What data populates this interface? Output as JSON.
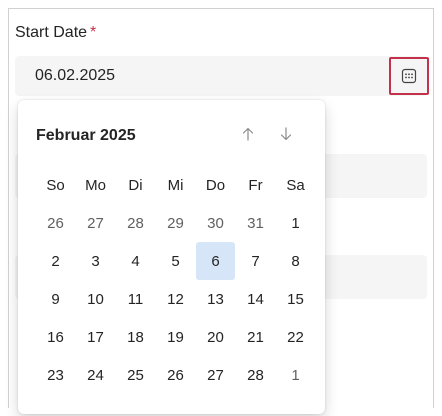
{
  "field": {
    "label": "Start Date",
    "required_mark": "*",
    "value": "06.02.2025",
    "calendar_button_icon": "calendar-icon"
  },
  "calendar": {
    "month_title": "Februar 2025",
    "prev_icon": "arrow-up-icon",
    "next_icon": "arrow-down-icon",
    "weekdays": [
      "So",
      "Mo",
      "Di",
      "Mi",
      "Do",
      "Fr",
      "Sa"
    ],
    "weeks": [
      [
        {
          "d": "26",
          "out": true
        },
        {
          "d": "27",
          "out": true
        },
        {
          "d": "28",
          "out": true
        },
        {
          "d": "29",
          "out": true
        },
        {
          "d": "30",
          "out": true
        },
        {
          "d": "31",
          "out": true
        },
        {
          "d": "1",
          "out": false
        }
      ],
      [
        {
          "d": "2"
        },
        {
          "d": "3"
        },
        {
          "d": "4"
        },
        {
          "d": "5"
        },
        {
          "d": "6",
          "selected": true
        },
        {
          "d": "7"
        },
        {
          "d": "8"
        }
      ],
      [
        {
          "d": "9"
        },
        {
          "d": "10"
        },
        {
          "d": "11"
        },
        {
          "d": "12"
        },
        {
          "d": "13"
        },
        {
          "d": "14"
        },
        {
          "d": "15"
        }
      ],
      [
        {
          "d": "16"
        },
        {
          "d": "17"
        },
        {
          "d": "18"
        },
        {
          "d": "19"
        },
        {
          "d": "20"
        },
        {
          "d": "21"
        },
        {
          "d": "22"
        }
      ],
      [
        {
          "d": "23"
        },
        {
          "d": "24"
        },
        {
          "d": "25"
        },
        {
          "d": "26"
        },
        {
          "d": "27"
        },
        {
          "d": "28"
        },
        {
          "d": "1",
          "out": true
        }
      ]
    ]
  },
  "colors": {
    "required": "#c4314b",
    "focus_border": "#c4314b",
    "selected_day_bg": "#d6e6f8",
    "field_bg": "#f5f5f5"
  }
}
